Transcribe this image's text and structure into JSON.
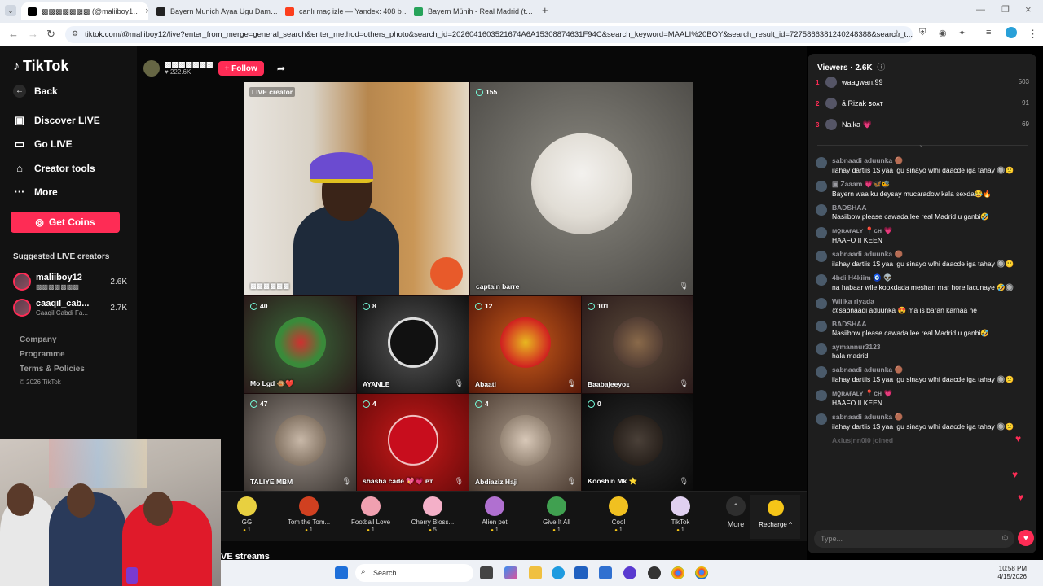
{
  "browser": {
    "tabs": [
      {
        "title": "▩▩▩▩▩▩▩ (@maliiboy1…",
        "active": true
      },
      {
        "title": "Bayern Munich Ayaa Ugu Dam…",
        "active": false
      },
      {
        "title": "canlı maç izle — Yandex: 408 b…",
        "active": false
      },
      {
        "title": "Bayern Münih - Real Madrid (t…",
        "active": false
      }
    ],
    "new_tab": "+",
    "url": "tiktok.com/@maliiboy12/live?enter_from_merge=general_search&enter_method=others_photo&search_id=2026041603521674A6A15308874631F94C&search_keyword=MAALI%20BOY&search_result_id=7275866381240248388&search_t..."
  },
  "sidebar": {
    "logo": "TikTok",
    "back": "Back",
    "nav": [
      {
        "label": "Discover LIVE",
        "icon": "tv-icon"
      },
      {
        "label": "Go LIVE",
        "icon": "camera-icon"
      },
      {
        "label": "Creator tools",
        "icon": "lightbulb-icon"
      },
      {
        "label": "More",
        "icon": "more-icon"
      }
    ],
    "get_coins": "Get Coins",
    "suggested_title": "Suggested LIVE creators",
    "suggested": [
      {
        "name": "maliiboy12",
        "sub": "▩▩▩▩▩▩▩",
        "count": "2.6K"
      },
      {
        "name": "caaqil_cab...",
        "sub": "Caaqil Cabdi Fa...",
        "count": "2.7K"
      }
    ],
    "footer": [
      "Company",
      "Programme",
      "Terms & Policies",
      "© 2026 TikTok"
    ]
  },
  "host": {
    "name": "▩▩▩▩▩▩▩",
    "likes": "♥ 222.6K",
    "follow": "+ Follow"
  },
  "stage": {
    "creator_label": "LIVE creator",
    "creator_name": "▩▩▩▩▩▩",
    "guest_main": {
      "count": "155",
      "name": "captain barre"
    },
    "grid": [
      {
        "count": "40",
        "name": "Mo Lgd 🐵❤️"
      },
      {
        "count": "8",
        "name": "AYANLE"
      },
      {
        "count": "12",
        "name": "Abaati"
      },
      {
        "count": "101",
        "name": "Baabajeeyoᴇ"
      },
      {
        "count": "47",
        "name": "TALIYE MBM"
      },
      {
        "count": "4",
        "name": "shasha cade 💖💗 ᴘᴛ"
      },
      {
        "count": "4",
        "name": "Abdiaziz Haji"
      },
      {
        "count": "0",
        "name": "Kooshin Mk ⭐"
      }
    ],
    "below_text": "VE streams"
  },
  "gifts": [
    {
      "name": "GG",
      "price": "1"
    },
    {
      "name": "Tom the Tom...",
      "price": "1"
    },
    {
      "name": "Football Love",
      "price": "1"
    },
    {
      "name": "Cherry Bloss...",
      "price": "5"
    },
    {
      "name": "Alien pet",
      "price": "1"
    },
    {
      "name": "Give It All",
      "price": "1"
    },
    {
      "name": "Cool",
      "price": "1"
    },
    {
      "name": "TikTok",
      "price": "1"
    }
  ],
  "gift_more": "More",
  "recharge": "Recharge ^",
  "viewers": {
    "title": "Viewers · 2.6K",
    "top": [
      {
        "rank": "1",
        "name": "waagwan.99",
        "count": "503"
      },
      {
        "rank": "2",
        "name": "ā.Rizak ꜱᴏᴀᴛ",
        "count": "91"
      },
      {
        "rank": "3",
        "name": "Nalka 💗",
        "count": "69"
      }
    ]
  },
  "chat": [
    {
      "user": "sabnaadi aduunka 🟤",
      "text": "ilahay dartiis 1$ yaa igu sinayo wlhi daacde iga tahay 🔘😕"
    },
    {
      "user": "▣ Zaaam 💗🦋🐝",
      "text": "Bayern waa ku deysay mucaradow kala sexda😂🔥"
    },
    {
      "user": "BADSHAA",
      "text": "Nasiibow please cawada lee real Madrid u ganbi🤣"
    },
    {
      "user": "ᴍჹʀᴀғᴀʟʏ 📍ᴄʜ 💗",
      "text": "HAAFO II KEEN"
    },
    {
      "user": "sabnaadi aduunka 🟤",
      "text": "ilahay dartiis 1$ yaa igu sinayo wlhi daacde iga tahay 🔘😕"
    },
    {
      "user": "4bdi H4kiim 🧿 👽",
      "text": "na habaar wlle kooxdada meshan mar hore lacunaye 🤣🔘"
    },
    {
      "user": "Wiilka riyada",
      "text": "@sabnaadi aduunka 😍 ma is baran karnaa he"
    },
    {
      "user": "BADSHAA",
      "text": "Nasiibow please cawada lee real Madrid u ganbi🤣"
    },
    {
      "user": "aymannur3123",
      "text": "hala madrid"
    },
    {
      "user": "sabnaadi aduunka 🟤",
      "text": "ilahay dartiis 1$ yaa igu sinayo wlhi daacde iga tahay 🔘😕"
    },
    {
      "user": "ᴍჹʀᴀғᴀʟʏ 📍ᴄʜ 💗",
      "text": "HAAFO II KEEN"
    },
    {
      "user": "sabnaadi aduunka 🟤",
      "text": "ilahay dartiis 1$ yaa igu sinayo wlhi daacde iga tahay 🔘😕"
    },
    {
      "user": "Axiusjnn0i0 joined",
      "text": ""
    }
  ],
  "chat_input_placeholder": "Type...",
  "taskbar": {
    "search": "Search",
    "time": "10:58 PM",
    "date": "4/15/2026"
  },
  "colors": {
    "accent": "#fe2c55",
    "coin": "#f5c518"
  }
}
